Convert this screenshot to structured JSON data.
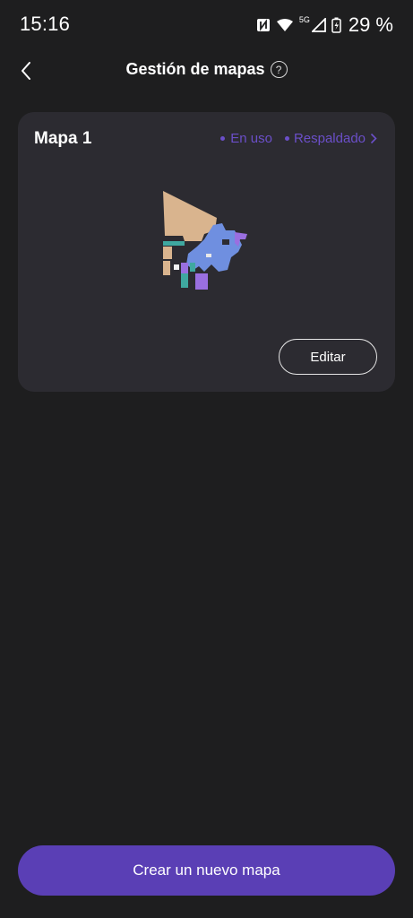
{
  "status_bar": {
    "time": "15:16",
    "network": "5G",
    "battery": "29 %"
  },
  "header": {
    "title": "Gestión de mapas",
    "help_symbol": "?"
  },
  "map_card": {
    "name": "Mapa 1",
    "status_in_use": "En uso",
    "status_backed_up": "Respaldado",
    "edit_label": "Editar"
  },
  "footer": {
    "create_label": "Crear un nuevo mapa"
  },
  "colors": {
    "accent": "#5a3fb5",
    "status_text": "#6b4fc9",
    "card_bg": "#2c2b31",
    "page_bg": "#1e1e1f",
    "room_beige": "#d9b48e",
    "room_blue": "#6f8fe0",
    "room_purple": "#9a6fe0",
    "room_teal": "#3fa8a0"
  },
  "icons": [
    "nfc-icon",
    "wifi-icon",
    "signal-icon",
    "battery-icon",
    "back-arrow-icon",
    "help-icon",
    "chevron-right-icon"
  ]
}
